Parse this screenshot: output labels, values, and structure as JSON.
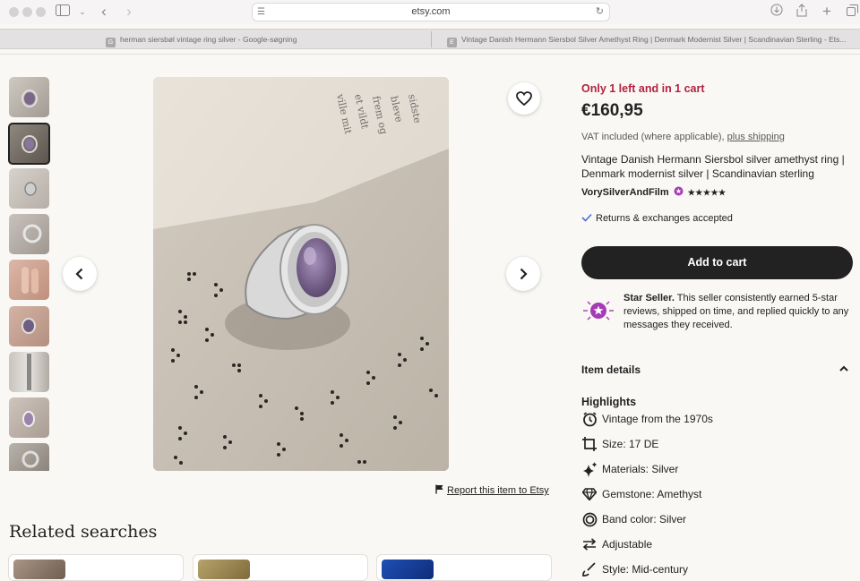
{
  "browser": {
    "url": "etsy.com",
    "tabs": [
      {
        "favicon": "G",
        "label": "herman siersbøl vintage ring silver - Google-søgning"
      },
      {
        "favicon": "E",
        "label": "Vintage Danish Hermann Siersbol Silver Amethyst Ring | Denmark Modernist Silver | Scandinavian Sterling - Ets..."
      }
    ]
  },
  "listing": {
    "stock_status": "Only 1 left and in 1 cart",
    "price": "€160,95",
    "vat_text": "VAT included (where applicable),",
    "shipping_link": "plus shipping",
    "title": "Vintage Danish Hermann Siersbol silver amethyst ring | Denmark modernist silver | Scandinavian sterling",
    "shop_name": "VorySilverAndFilm",
    "rating_stars": "★★★★★",
    "returns": "Returns & exchanges accepted",
    "add_to_cart": "Add to cart",
    "star_seller_title": "Star Seller.",
    "star_seller_text": "This seller consistently earned 5-star reviews, shipped on time, and replied quickly to any messages they received.",
    "item_details": "Item details",
    "highlights_title": "Highlights",
    "highlights": [
      {
        "icon": "clock-icon",
        "text": "Vintage from the 1970s"
      },
      {
        "icon": "size-icon",
        "text": "Size: 17 DE"
      },
      {
        "icon": "sparkle-icon",
        "text": "Materials: Silver"
      },
      {
        "icon": "gem-icon",
        "text": "Gemstone: Amethyst"
      },
      {
        "icon": "ring-icon",
        "text": "Band color: Silver"
      },
      {
        "icon": "arrows-icon",
        "text": "Adjustable"
      },
      {
        "icon": "brush-icon",
        "text": "Style: Mid-century"
      }
    ],
    "report_link": "Report this item to Etsy"
  },
  "related": {
    "heading": "Related searches"
  },
  "colors": {
    "stock": "#b1233d",
    "cart_button": "#222222",
    "star_seller": "#a53bb5",
    "check": "#4b6ed1"
  }
}
